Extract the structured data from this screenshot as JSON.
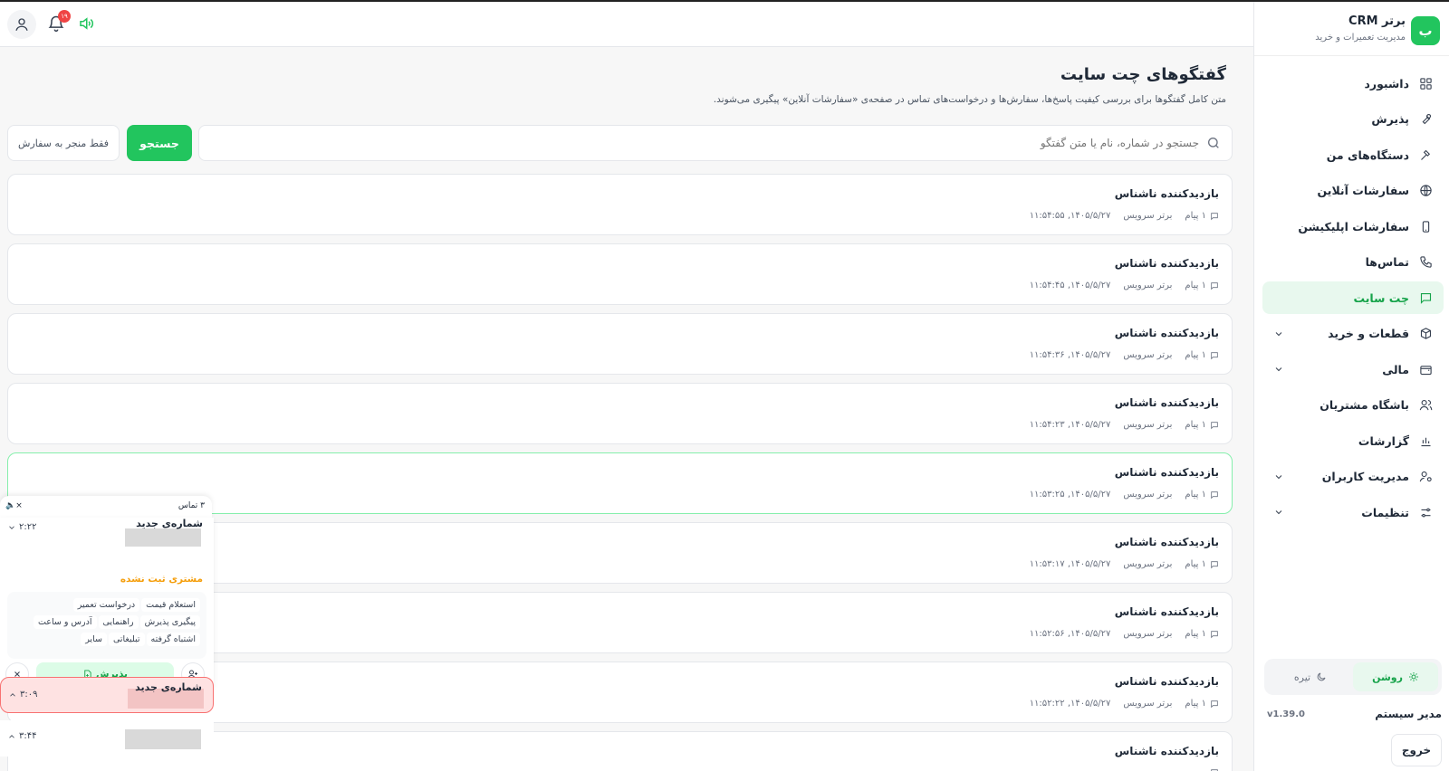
{
  "brand": {
    "logo_letter": "ب",
    "title": "برتر CRM",
    "subtitle": "مدیریت تعمیرات و خرید"
  },
  "nav": [
    {
      "label": "داشبورد",
      "icon": "dashboard-icon"
    },
    {
      "label": "پذیرش",
      "icon": "wrench-icon"
    },
    {
      "label": "دستگاه‌های من",
      "icon": "hammer-icon"
    },
    {
      "label": "سفارشات آنلاین",
      "icon": "globe-icon"
    },
    {
      "label": "سفارشات اپلیکیشن",
      "icon": "phone-device-icon"
    },
    {
      "label": "تماس‌ها",
      "icon": "phone-call-icon"
    },
    {
      "label": "چت سایت",
      "icon": "chat-icon",
      "active": true
    },
    {
      "label": "قطعات و خرید",
      "icon": "package-icon",
      "expandable": true
    },
    {
      "label": "مالی",
      "icon": "wallet-icon",
      "expandable": true
    },
    {
      "label": "باشگاه مشتریان",
      "icon": "users-icon"
    },
    {
      "label": "گزارشات",
      "icon": "bar-chart-icon"
    },
    {
      "label": "مدیریت کاربران",
      "icon": "user-cog-icon",
      "expandable": true
    },
    {
      "label": "تنظیمات",
      "icon": "sliders-icon",
      "expandable": true
    }
  ],
  "theme": {
    "light": "روشن",
    "dark": "تیره",
    "selected": "light"
  },
  "footer": {
    "user": "مدیر سیستم",
    "version": "v1.39.0",
    "logout": "خروج"
  },
  "topbar": {
    "notif_count": "۱۹"
  },
  "page": {
    "title": "گفتگوهای چت سایت",
    "description": "متن کامل گفتگوها برای بررسی کیفیت پاسخ‌ها، سفارش‌ها و درخواست‌های تماس در صفحه‌ی «سفارشات آنلاین» پیگیری می‌شوند."
  },
  "search": {
    "placeholder": "جستجو در شماره، نام یا متن گفتگو",
    "button": "جستجو",
    "filter": "فقط منجر به سفارش"
  },
  "chats": [
    {
      "name": "بازدیدکننده ناشناس",
      "messages": "۱ پیام",
      "site": "برتر سرویس",
      "datetime": "۱۴۰۵/۵/۲۷, ۱۱:۵۴:۵۵"
    },
    {
      "name": "بازدیدکننده ناشناس",
      "messages": "۱ پیام",
      "site": "برتر سرویس",
      "datetime": "۱۴۰۵/۵/۲۷, ۱۱:۵۴:۴۵"
    },
    {
      "name": "بازدیدکننده ناشناس",
      "messages": "۱ پیام",
      "site": "برتر سرویس",
      "datetime": "۱۴۰۵/۵/۲۷, ۱۱:۵۴:۳۶"
    },
    {
      "name": "بازدیدکننده ناشناس",
      "messages": "۱ پیام",
      "site": "برتر سرویس",
      "datetime": "۱۴۰۵/۵/۲۷, ۱۱:۵۴:۲۳"
    },
    {
      "name": "بازدیدکننده ناشناس",
      "messages": "۱ پیام",
      "site": "برتر سرویس",
      "datetime": "۱۴۰۵/۵/۲۷, ۱۱:۵۳:۲۵"
    },
    {
      "name": "بازدیدکننده ناشناس",
      "messages": "۱ پیام",
      "site": "برتر سرویس",
      "datetime": "۱۴۰۵/۵/۲۷, ۱۱:۵۳:۱۷"
    },
    {
      "name": "بازدیدکننده ناشناس",
      "messages": "۱ پیام",
      "site": "برتر سرویس",
      "datetime": "۱۴۰۵/۵/۲۷, ۱۱:۵۲:۵۶"
    },
    {
      "name": "بازدیدکننده ناشناس",
      "messages": "۱ پیام",
      "site": "برتر سرویس",
      "datetime": "۱۴۰۵/۵/۲۷, ۱۱:۵۲:۲۲"
    },
    {
      "name": "بازدیدکننده ناشناس",
      "messages": "",
      "site": "",
      "datetime": ""
    }
  ],
  "calls": {
    "count": "۳ تماس",
    "mute": "🔈×",
    "card1": {
      "number": "شماره‌ی جدید",
      "time": "۲:۲۲",
      "status": "مشتری ثبت نشده",
      "tags": [
        "استعلام قیمت",
        "درخواست تعمیر",
        "پیگیری پذیرش",
        "راهنمایی",
        "آدرس و ساعت",
        "اشتباه گرفته",
        "تبلیغاتی",
        "سایر"
      ],
      "accept": "پذیرش"
    },
    "card2": {
      "number": "شماره‌ی جدید",
      "time": "۳:۰۹"
    },
    "card3": {
      "time": "۳:۴۴"
    }
  }
}
